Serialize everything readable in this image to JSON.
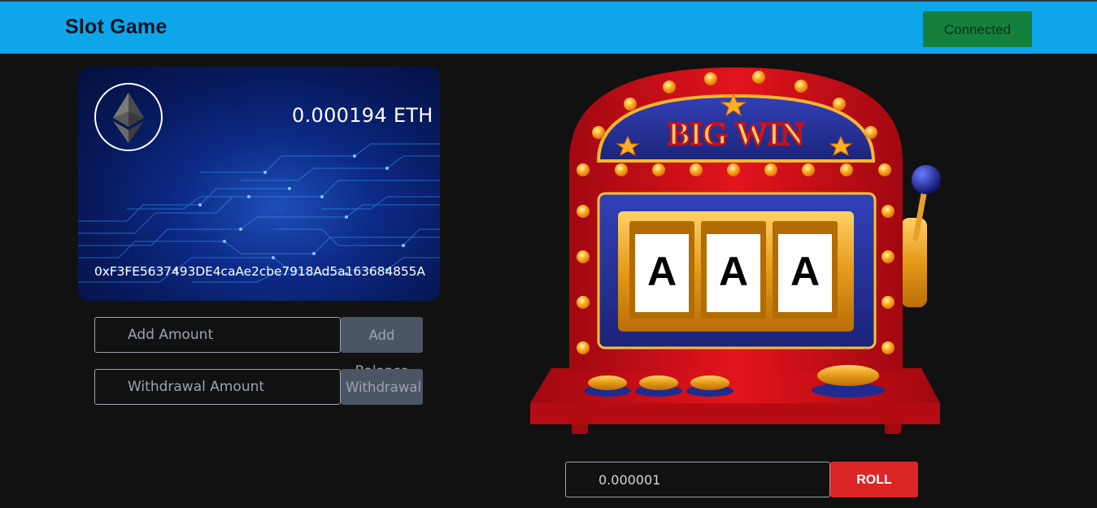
{
  "header": {
    "title": "Slot Game",
    "connect_label": "Connected"
  },
  "wallet": {
    "balance": "0.000194 ETH",
    "address": "0xF3FE5637493DE4caAe2cbe7918Ad5a163684855A"
  },
  "deposit": {
    "placeholder": "Add Amount",
    "button_label": "Add Balance"
  },
  "withdraw": {
    "placeholder": "Withdrawal Amount",
    "button_label": "Withdrawal"
  },
  "slot_machine": {
    "banner": "BIG WIN",
    "reels": [
      "A",
      "A",
      "A"
    ]
  },
  "bet": {
    "value": "0.000001",
    "roll_label": "ROLL"
  },
  "colors": {
    "header_bg": "#0ea5e9",
    "connected_bg": "#15803d",
    "roll_bg": "#dc2626",
    "machine_red": "#d0101a"
  }
}
